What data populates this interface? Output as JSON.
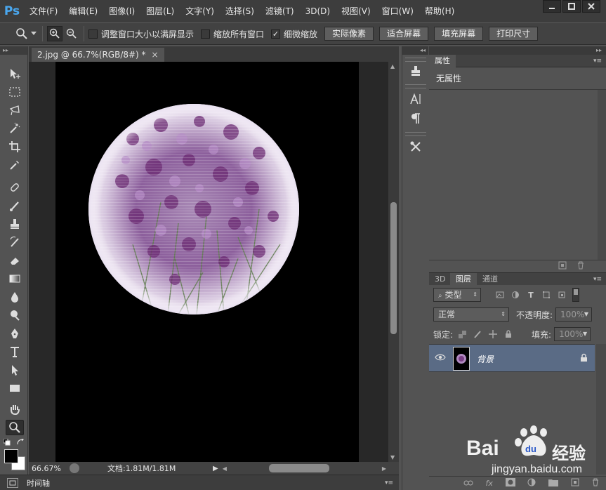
{
  "app": {
    "logo": "Ps"
  },
  "menu": {
    "items": [
      "文件(F)",
      "编辑(E)",
      "图像(I)",
      "图层(L)",
      "文字(Y)",
      "选择(S)",
      "滤镜(T)",
      "3D(D)",
      "视图(V)",
      "窗口(W)",
      "帮助(H)"
    ]
  },
  "options": {
    "checkbox_resize": "调整窗口大小以满屏显示",
    "checkbox_resize_checked": false,
    "checkbox_zoom_all": "缩放所有窗口",
    "checkbox_zoom_all_checked": false,
    "checkbox_scrubby": "细微缩放",
    "checkbox_scrubby_checked": true,
    "btn_actual": "实际像素",
    "btn_fit": "适合屏幕",
    "btn_fill": "填充屏幕",
    "btn_print": "打印尺寸"
  },
  "document": {
    "tab_title": "2.jpg @ 66.7%(RGB/8#) *",
    "close_glyph": "×"
  },
  "status": {
    "zoom": "66.67%",
    "doc_info": "文档:1.81M/1.81M"
  },
  "timeline": {
    "label": "时间轴"
  },
  "properties": {
    "tab": "属性",
    "title": "无属性"
  },
  "layers": {
    "tabs": [
      "3D",
      "图层",
      "通道"
    ],
    "active_tab": "图层",
    "filter_kind": "类型",
    "blend_mode": "正常",
    "opacity_label": "不透明度:",
    "opacity_value": "100%",
    "lock_label": "锁定:",
    "fill_label": "填充:",
    "fill_value": "100%",
    "layer_name": "背景"
  },
  "colors": {
    "foreground": "#000000",
    "background": "#ffffff",
    "selected_layer": "#5a6b85",
    "ps_logo": "#4aa8f0"
  },
  "watermark": {
    "brand": "Bai",
    "brand_cn": "经验",
    "url": "jingyan.baidu.com"
  }
}
